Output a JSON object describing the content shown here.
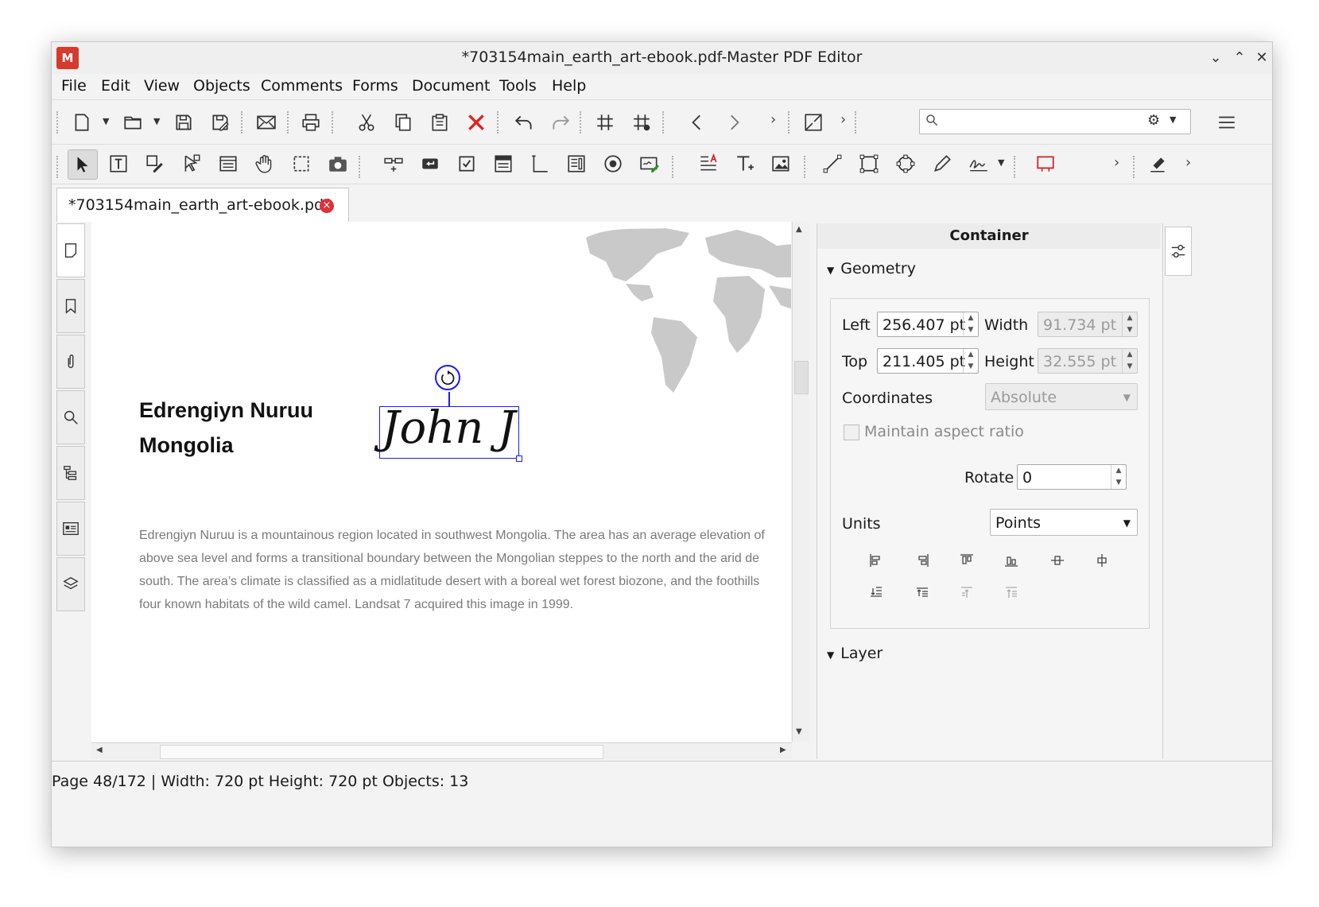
{
  "window": {
    "title": "*703154main_earth_art-ebook.pdf-Master PDF Editor",
    "logo_text": "M"
  },
  "menu": [
    "File",
    "Edit",
    "View",
    "Objects",
    "Comments",
    "Forms",
    "Document",
    "Tools",
    "Help"
  ],
  "toolbar1_icons": [
    "new-document-icon",
    "open-folder-icon",
    "save-icon",
    "save-as-icon",
    "email-icon",
    "print-icon",
    "cut-icon",
    "copy-icon",
    "paste-icon",
    "delete-icon",
    "undo-icon",
    "redo-icon",
    "grid-icon",
    "snap-grid-icon",
    "previous-icon",
    "next-icon",
    "fit-page-icon",
    "search-icon",
    "settings-icon",
    "menu-icon"
  ],
  "toolbar2_icons": [
    "select-arrow-icon",
    "text-edit-icon",
    "edit-object-icon",
    "edit-forms-icon",
    "text-select-icon",
    "hand-icon",
    "marquee-select-icon",
    "snapshot-icon",
    "link-icon",
    "button-field-icon",
    "checkbox-field-icon",
    "combobox-field-icon",
    "text-field-icon",
    "listbox-field-icon",
    "radio-button-icon",
    "signature-field-icon",
    "add-text-icon",
    "typewriter-icon",
    "add-image-icon",
    "line-icon",
    "rectangle-icon",
    "ellipse-icon",
    "pencil-icon",
    "sign-icon",
    "highlight-rect-icon",
    "eraser-icon"
  ],
  "document_tab": {
    "label": "*703154main_earth_art-ebook.pdf",
    "close": "×"
  },
  "page": {
    "heading_line1": "Edrengiyn Nuruu",
    "heading_line2": "Mongolia",
    "signature_text": "John J",
    "paragraph_lines": [
      "Edrengiyn Nuruu is a mountainous region located in southwest Mongolia. The area has an average elevation of",
      "above sea level and forms a transitional boundary between the Mongolian steppes to the north and the arid de",
      "south. The area’s climate is classified as a midlatitude desert with a boreal wet forest biozone, and the foothills",
      "four known habitats of the wild camel. Landsat 7 acquired this image in 1999."
    ]
  },
  "panel": {
    "title": "Container",
    "geometry_label": "Geometry",
    "left_label": "Left",
    "left_value": "256.407 pt",
    "width_label": "Width",
    "width_value": "91.734 pt",
    "top_label": "Top",
    "top_value": "211.405 pt",
    "height_label": "Height",
    "height_value": "32.555 pt",
    "coordinates_label": "Coordinates",
    "coordinates_value": "Absolute",
    "maintain_aspect_label": "Maintain aspect ratio",
    "rotate_label": "Rotate",
    "rotate_value": "0",
    "units_label": "Units",
    "units_value": "Points",
    "layer_label": "Layer"
  },
  "status": {
    "text": "Page 48/172 | Width: 720 pt Height: 720 pt Objects: 13"
  },
  "colors": {
    "accent_red": "#d63a2f",
    "selection_blue": "#1a1aff",
    "map_gray": "#c9c9c9"
  }
}
